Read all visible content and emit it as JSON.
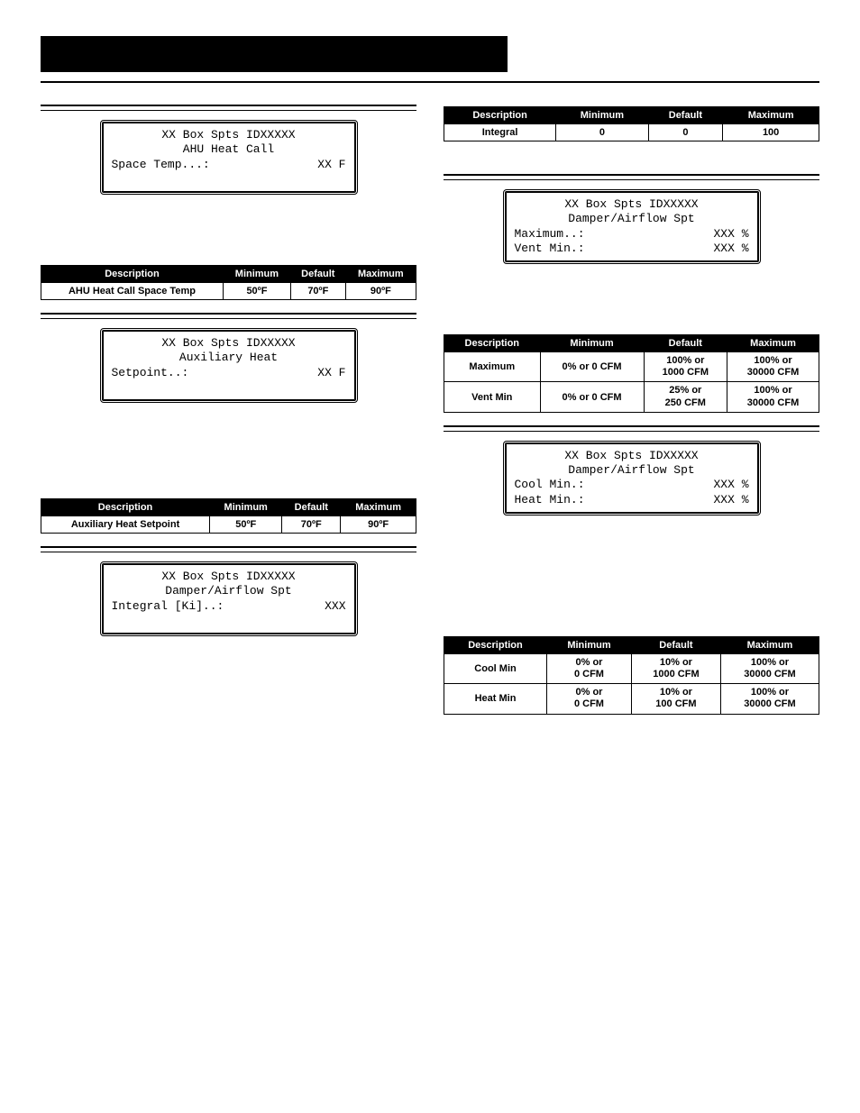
{
  "tableHeaders": {
    "desc": "Description",
    "min": "Minimum",
    "def": "Default",
    "max": "Maximum"
  },
  "lcd": {
    "header": "XX Box Spts IDXXXXX",
    "ahuHeat": {
      "t2": "AHU Heat Call",
      "l1a": "Space Temp...:",
      "l1b": "XX F"
    },
    "auxHeat": {
      "t2": "Auxiliary Heat",
      "l1a": "Setpoint..:",
      "l1b": "XX F"
    },
    "damperKi": {
      "t2": "Damper/Airflow Spt",
      "l1a": "Integral [Ki]..:",
      "l1b": "XXX"
    },
    "damperMaxVent": {
      "t2": "Damper/Airflow Spt",
      "l1a": "Maximum..:",
      "l1b": "XXX %",
      "l2a": "Vent Min.:",
      "l2b": "XXX %"
    },
    "damperCoolHeat": {
      "t2": "Damper/Airflow Spt",
      "l1a": "Cool Min.:",
      "l1b": "XXX %",
      "l2a": "Heat Min.:",
      "l2b": "XXX %"
    }
  },
  "tables": {
    "integral": {
      "desc": "Integral",
      "min": "0",
      "def": "0",
      "max": "100"
    },
    "ahuHeat": {
      "desc": "AHU Heat Call Space Temp",
      "min": "50ºF",
      "def": "70ºF",
      "max": "90ºF"
    },
    "auxHeat": {
      "desc": "Auxiliary Heat Setpoint",
      "min": "50ºF",
      "def": "70ºF",
      "max": "90ºF"
    },
    "maxVent": {
      "r1": {
        "desc": "Maximum",
        "min": "0% or 0 CFM",
        "def1": "100% or",
        "def2": "1000 CFM",
        "max1": "100% or",
        "max2": "30000 CFM"
      },
      "r2": {
        "desc": "Vent Min",
        "min": "0% or 0 CFM",
        "def1": "25% or",
        "def2": "250 CFM",
        "max1": "100% or",
        "max2": "30000 CFM"
      }
    },
    "coolHeat": {
      "r1": {
        "desc": "Cool Min",
        "min1": "0% or",
        "min2": "0 CFM",
        "def1": "10% or",
        "def2": "1000 CFM",
        "max1": "100% or",
        "max2": "30000 CFM"
      },
      "r2": {
        "desc": "Heat Min",
        "min1": "0% or",
        "min2": "0 CFM",
        "def1": "10% or",
        "def2": "100 CFM",
        "max1": "100% or",
        "max2": "30000 CFM"
      }
    }
  }
}
